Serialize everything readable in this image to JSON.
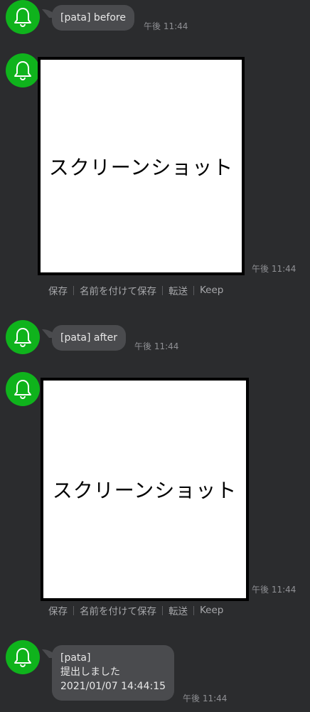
{
  "messages": [
    {
      "type": "text",
      "text": "[pata] before",
      "time": "午後 11:44"
    },
    {
      "type": "image",
      "image_label": "スクリーンショット",
      "time": "午後 11:44",
      "actions": [
        "保存",
        "名前を付けて保存",
        "転送",
        "Keep"
      ]
    },
    {
      "type": "text",
      "text": "[pata] after",
      "time": "午後 11:44"
    },
    {
      "type": "image",
      "image_label": "スクリーンショット",
      "time": "午後 11:44",
      "actions": [
        "保存",
        "名前を付けて保存",
        "転送",
        "Keep"
      ]
    },
    {
      "type": "text",
      "lines": [
        "[pata]",
        "提出しました",
        "2021/01/07 14:44:15"
      ],
      "time": "午後 11:44"
    }
  ],
  "avatar_icon": "bell-icon",
  "colors": {
    "background": "#2b2c2e",
    "avatar": "#0fb31c",
    "bubble": "#4a4b4e"
  }
}
